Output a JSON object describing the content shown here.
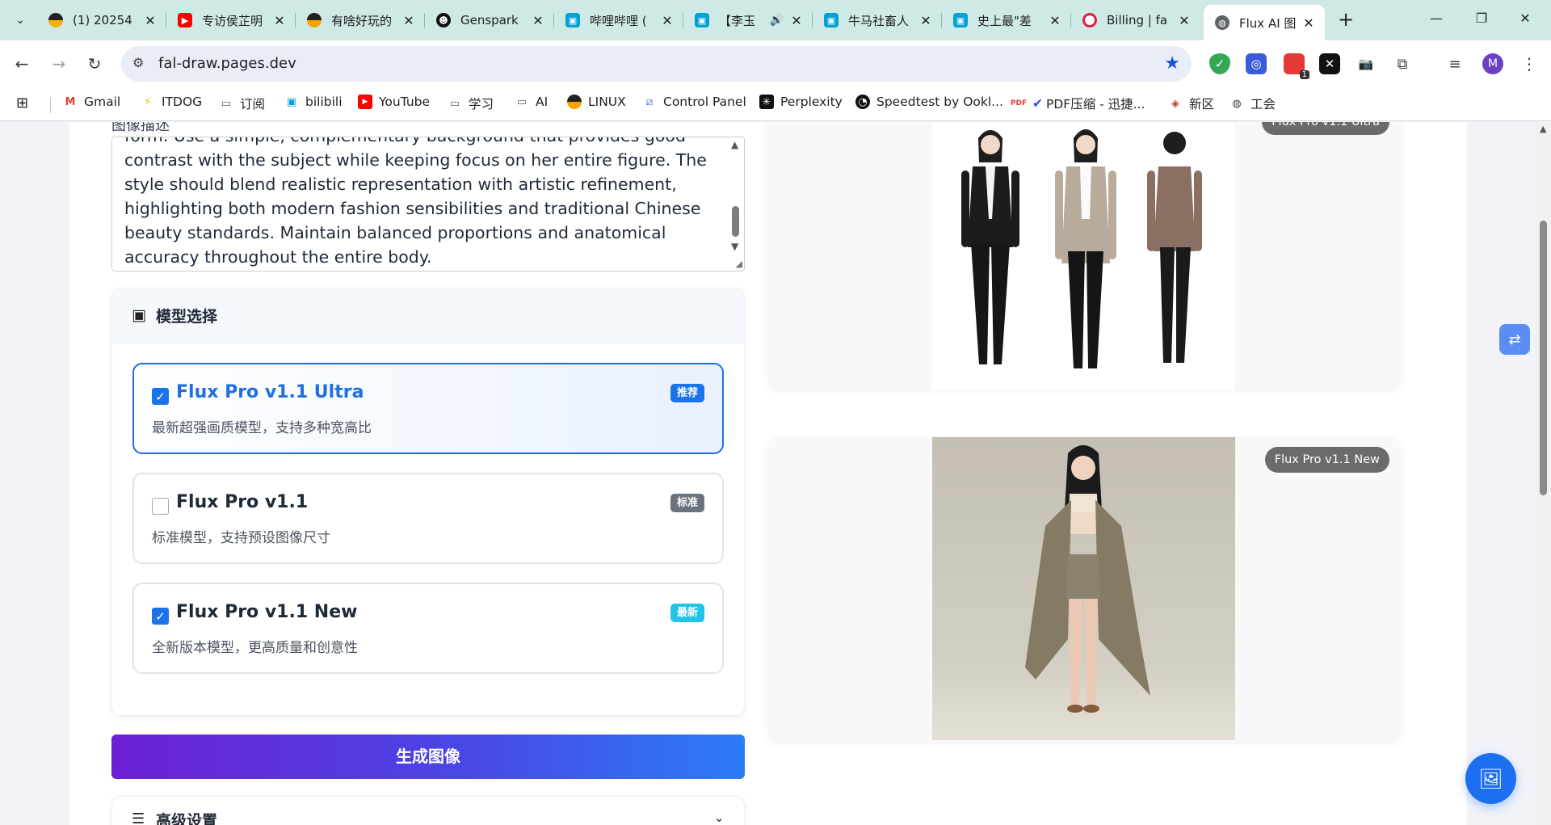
{
  "browser": {
    "tabs": [
      {
        "title": "(1) 20254",
        "icon": "bilibili-tv-icon",
        "color": "#fb7299",
        "active": false
      },
      {
        "title": "专访侯芷明",
        "icon": "youtube-icon",
        "color": "#ff0000",
        "active": false
      },
      {
        "title": "有啥好玩的",
        "icon": "globe-icon",
        "color": "#f4a300",
        "active": false
      },
      {
        "title": "Genspark",
        "icon": "genspark-icon",
        "color": "#111111",
        "active": false
      },
      {
        "title": "哔哩哔哩 (",
        "icon": "bilibili-tv-icon",
        "color": "#00a1d6",
        "active": false
      },
      {
        "title": "【李玉",
        "icon": "bilibili-tv-icon",
        "color": "#00a1d6",
        "active": false
      },
      {
        "title": "牛马社畜人",
        "icon": "bilibili-tv-icon",
        "color": "#00a1d6",
        "active": false
      },
      {
        "title": "史上最\"差",
        "icon": "bilibili-tv-icon",
        "color": "#00a1d6",
        "active": false
      },
      {
        "title": "Billing | fa",
        "icon": "billing-icon",
        "color": "#e11d48",
        "active": false
      },
      {
        "title": "Flux AI 图",
        "icon": "globe-icon",
        "color": "#5f6368",
        "active": true
      }
    ],
    "url": "fal-draw.pages.dev",
    "bookmarks": [
      {
        "label": "Gmail",
        "icon": "gmail-icon"
      },
      {
        "label": "ITDOG",
        "icon": "itdog-icon"
      },
      {
        "label": "订阅",
        "icon": "folder-icon"
      },
      {
        "label": "bilibili",
        "icon": "bilibili-tv-icon"
      },
      {
        "label": "YouTube",
        "icon": "youtube-icon"
      },
      {
        "label": "学习",
        "icon": "folder-icon"
      },
      {
        "label": "AI",
        "icon": "folder-icon"
      },
      {
        "label": "LINUX",
        "icon": "linux-icon"
      },
      {
        "label": "Control Panel",
        "icon": "control-panel-icon"
      },
      {
        "label": "Perplexity",
        "icon": "perplexity-icon"
      },
      {
        "label": "Speedtest by Ookl...",
        "icon": "speedtest-icon"
      },
      {
        "label": "PDF压缩 - 迅捷...",
        "icon": "pdf-icon"
      },
      {
        "label": "新区",
        "icon": "news-icon"
      },
      {
        "label": "工会",
        "icon": "globe-icon"
      }
    ],
    "profile_initial": "M",
    "extension_badge": "1"
  },
  "prompt": {
    "label": "图像描述",
    "text": "form. Use a simple, complementary background that provides good contrast with the subject while keeping focus on her entire figure. The style should blend realistic representation with artistic refinement, highlighting both modern fashion sensibilities and traditional Chinese beauty standards. Maintain balanced proportions and anatomical accuracy throughout the entire body."
  },
  "models": {
    "title": "模型选择",
    "options": [
      {
        "name": "Flux Pro v1.1 Ultra",
        "desc": "最新超强画质模型，支持多种宽高比",
        "badge": "推荐",
        "badge_color": "#1a73e8",
        "checked": true,
        "selected": true
      },
      {
        "name": "Flux Pro v1.1",
        "desc": "标准模型，支持预设图像尺寸",
        "badge": "标准",
        "badge_color": "#6b7280",
        "checked": false,
        "selected": false
      },
      {
        "name": "Flux Pro v1.1 New",
        "desc": "全新版本模型，更高质量和创意性",
        "badge": "最新",
        "badge_color": "#22c3e6",
        "checked": true,
        "selected": false
      }
    ]
  },
  "generate_label": "生成图像",
  "advanced_title": "高级设置",
  "results": [
    {
      "model_tag": "Flux Pro v1.1 Ultra"
    },
    {
      "model_tag": "Flux Pro v1.1 New"
    }
  ],
  "colors": {
    "accent": "#1f6fde",
    "generate_start": "#6d1fd6",
    "generate_end": "#2b7cf6"
  }
}
